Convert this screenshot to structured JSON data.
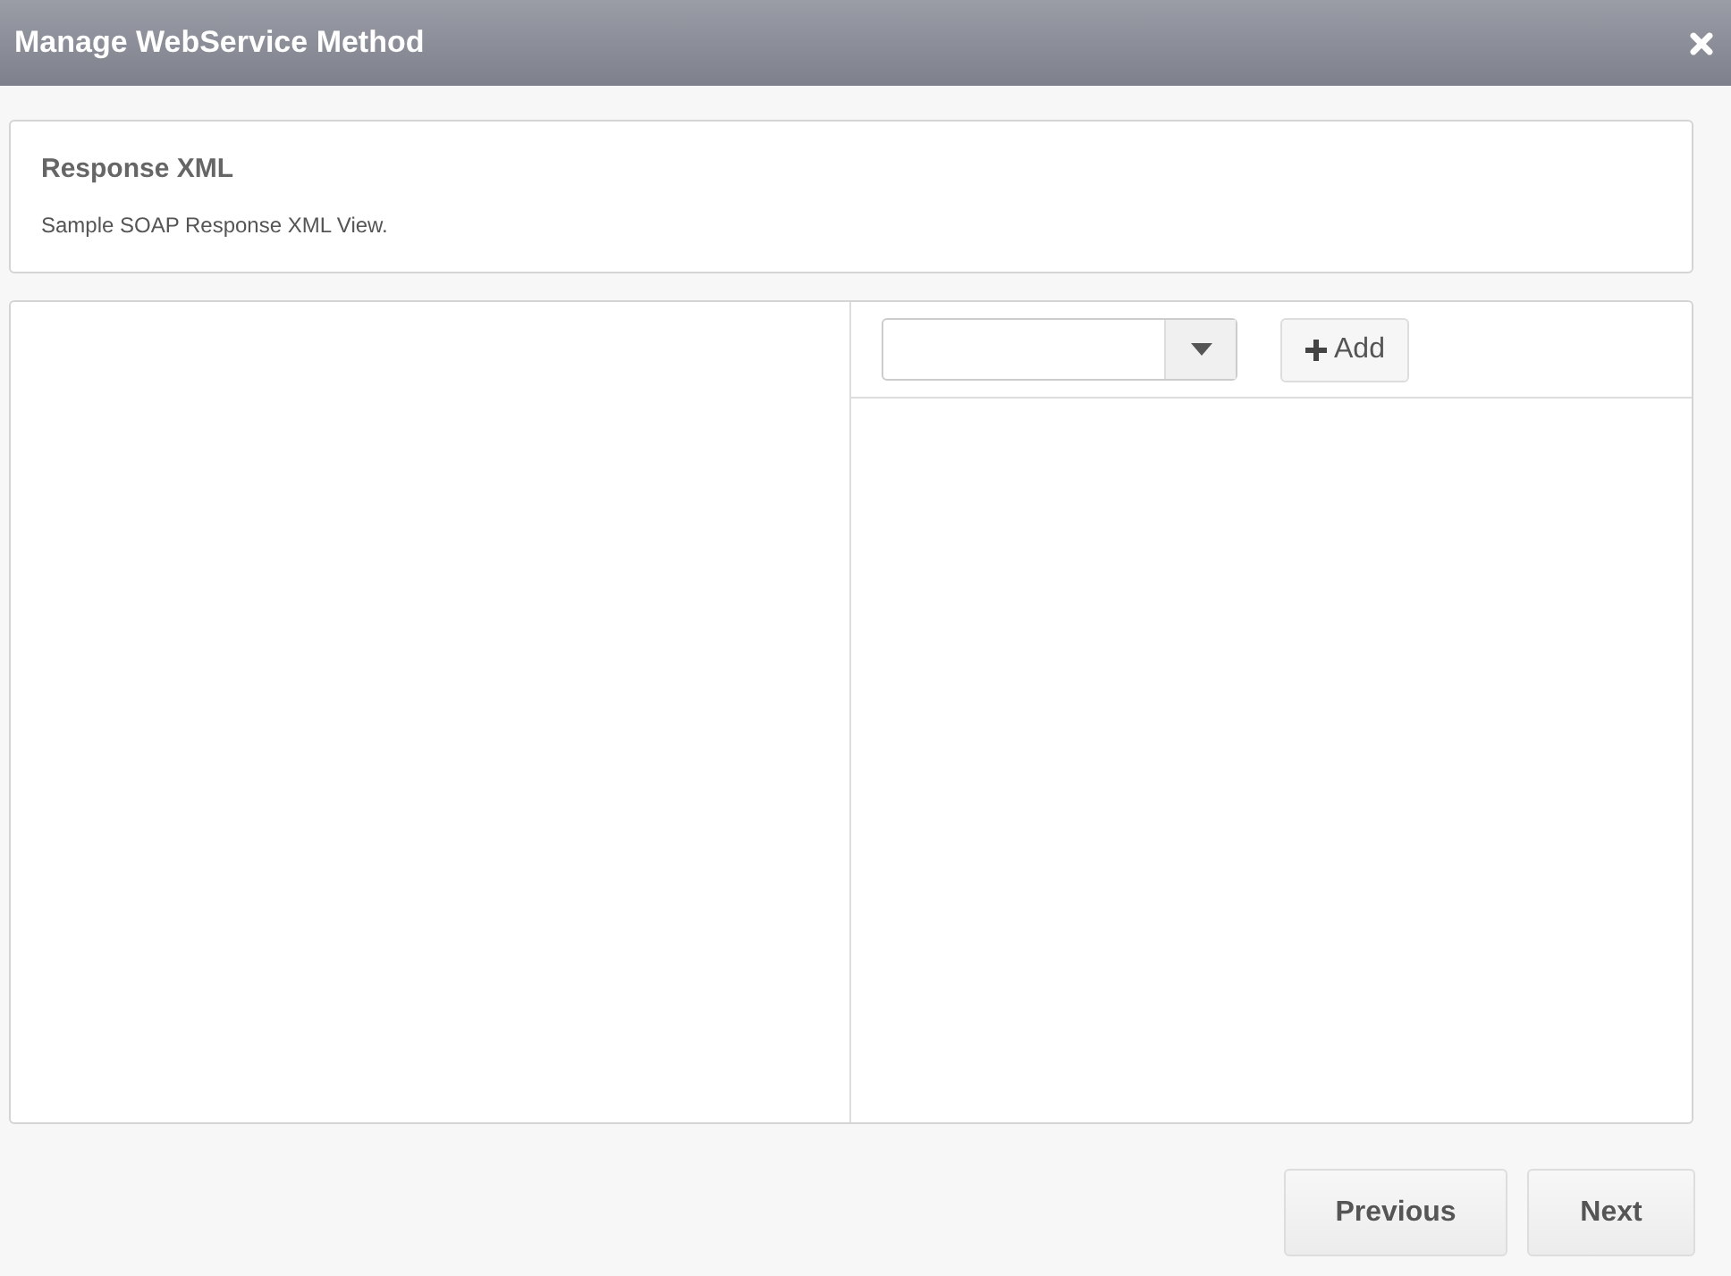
{
  "window": {
    "title": "Manage WebService Method"
  },
  "info": {
    "title": "Response XML",
    "description": "Sample SOAP Response XML View."
  },
  "toolbar": {
    "add_button": "Add"
  },
  "buttons": [
    "Previous",
    "Next"
  ]
}
